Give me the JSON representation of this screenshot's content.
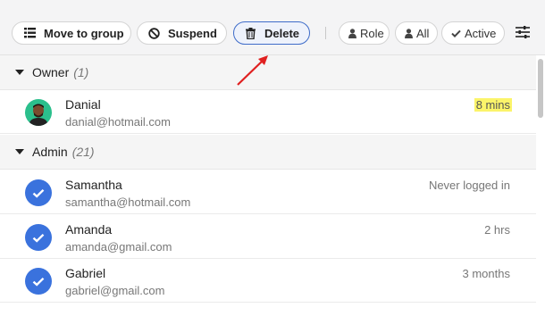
{
  "toolbar": {
    "move_label": "Move to group",
    "suspend_label": "Suspend",
    "delete_label": "Delete",
    "filters": [
      {
        "label": "Role",
        "icon": "person-icon"
      },
      {
        "label": "All",
        "icon": "person-icon"
      },
      {
        "label": "Active",
        "icon": "checkmark-icon"
      }
    ],
    "settings_icon": "sliders-icon"
  },
  "groups": [
    {
      "name": "Owner",
      "count": "(1)",
      "users": [
        {
          "name": "Danial",
          "email": "danial@hotmail.com",
          "last_seen": "8 mins",
          "highlighted": true,
          "selected": false
        }
      ]
    },
    {
      "name": "Admin",
      "count": "(21)",
      "users": [
        {
          "name": "Samantha",
          "email": "samantha@hotmail.com",
          "last_seen": "Never logged in",
          "selected": true
        },
        {
          "name": "Amanda",
          "email": "amanda@gmail.com",
          "last_seen": "2 hrs",
          "selected": true
        },
        {
          "name": "Gabriel",
          "email": "gabriel@gmail.com",
          "last_seen": "3 months",
          "selected": true
        }
      ]
    }
  ],
  "colors": {
    "accent": "#3a72dd",
    "highlight": "#fbf46a",
    "annotation_arrow": "#e02020"
  }
}
